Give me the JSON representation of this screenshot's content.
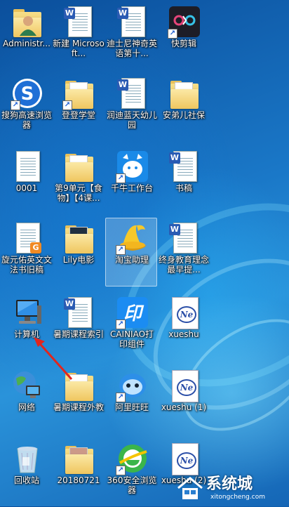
{
  "desktop": {
    "icons": [
      {
        "id": "administrator",
        "label": "Administr...",
        "icon": "user-folder-icon",
        "shortcut": false
      },
      {
        "id": "new-word-doc",
        "label": "新建 Microsoft...",
        "icon": "word-document-icon",
        "shortcut": false
      },
      {
        "id": "disney-english",
        "label": "迪士尼神奇英语第十...",
        "icon": "word-document-icon",
        "shortcut": false
      },
      {
        "id": "kuaijianji",
        "label": "快剪辑",
        "icon": "kuaijianji-app-icon",
        "shortcut": true
      },
      {
        "id": "sogou-browser",
        "label": "搜狗高速浏览器",
        "icon": "sogou-browser-icon",
        "shortcut": true
      },
      {
        "id": "dengdengxuetang",
        "label": "登登学堂",
        "icon": "folder-icon",
        "shortcut": true
      },
      {
        "id": "rundi-kindergarten",
        "label": "润迪蓝天幼儿园",
        "icon": "word-document-icon",
        "shortcut": false
      },
      {
        "id": "anyi-social",
        "label": "安弟儿社保",
        "icon": "folder-icon",
        "shortcut": false
      },
      {
        "id": "file-0001",
        "label": "0001",
        "icon": "text-document-icon",
        "shortcut": false
      },
      {
        "id": "unit9-food",
        "label": "第9单元【食物】【4课...",
        "icon": "folder-icon",
        "shortcut": false
      },
      {
        "id": "qianniu",
        "label": "千牛工作台",
        "icon": "qianniu-app-icon",
        "shortcut": true
      },
      {
        "id": "shugao",
        "label": "书稿",
        "icon": "word-document-icon",
        "shortcut": false
      },
      {
        "id": "xuanyuanyou",
        "label": "旋元佑英文文法书旧稿",
        "icon": "pdf-document-icon",
        "shortcut": false
      },
      {
        "id": "lily-movie",
        "label": "Lily电影",
        "icon": "folder-icon",
        "shortcut": false
      },
      {
        "id": "taobao-assistant",
        "label": "淘宝助理",
        "icon": "taobao-assistant-icon",
        "shortcut": true,
        "selected": true
      },
      {
        "id": "lifelong-education",
        "label": "终身教育理念最早提...",
        "icon": "word-document-icon",
        "shortcut": false
      },
      {
        "id": "computer",
        "label": "计算机",
        "icon": "computer-icon",
        "shortcut": false
      },
      {
        "id": "summer-course-1",
        "label": "暑期课程索引",
        "icon": "word-document-icon",
        "shortcut": false
      },
      {
        "id": "cainiao-print",
        "label": "CAINIAO打印组件",
        "icon": "cainiao-print-icon",
        "shortcut": true
      },
      {
        "id": "xueshu",
        "label": "xueshu",
        "icon": "ne-document-icon",
        "shortcut": false
      },
      {
        "id": "network",
        "label": "网络",
        "icon": "network-icon",
        "shortcut": false
      },
      {
        "id": "summer-course-2",
        "label": "暑期课程外教",
        "icon": "folder-icon",
        "shortcut": false
      },
      {
        "id": "aliwangwang",
        "label": "阿里旺旺",
        "icon": "aliwangwang-icon",
        "shortcut": true
      },
      {
        "id": "xueshu-1",
        "label": "xueshu (1)",
        "icon": "ne-document-icon",
        "shortcut": false
      },
      {
        "id": "recycle-bin",
        "label": "回收站",
        "icon": "recycle-bin-icon",
        "shortcut": false
      },
      {
        "id": "folder-20180721",
        "label": "20180721",
        "icon": "folder-icon",
        "shortcut": false
      },
      {
        "id": "browser-360",
        "label": "360安全浏览器",
        "icon": "browser-360-icon",
        "shortcut": true
      },
      {
        "id": "xueshu-2",
        "label": "xueshu (2)",
        "icon": "ne-document-icon",
        "shortcut": false
      }
    ]
  },
  "watermark": {
    "text": "系统城",
    "url": "xitongcheng.com"
  },
  "colors": {
    "desktop_blue": "#1a78c8",
    "word_blue": "#2a5bb3",
    "arrow_red": "#e0261f"
  }
}
